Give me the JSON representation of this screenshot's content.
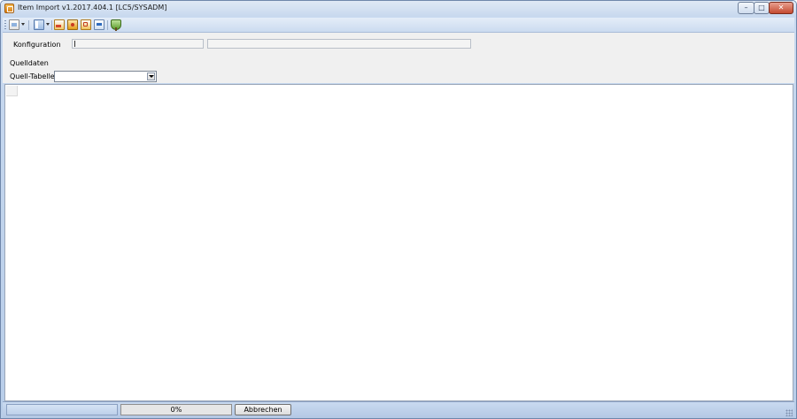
{
  "window": {
    "title": "Item Import v1.2017.404.1 [LC5/SYSADM]",
    "controls": {
      "minimize": "–",
      "maximize": "□",
      "close": "✕"
    }
  },
  "toolbar": {
    "icons": [
      "new-document-icon",
      "sheet-icon",
      "import-icon",
      "run-icon",
      "edit-icon",
      "window-icon",
      "tree-icon"
    ]
  },
  "form": {
    "konfiguration_label": "Konfiguration",
    "konfiguration_value": "",
    "konfiguration_description": "",
    "quelldaten_label": "Quelldaten",
    "quell_tabelle_label": "Quell-Tabelle",
    "quell_tabelle_value": ""
  },
  "statusbar": {
    "status_text": "",
    "progress_percent": 0,
    "progress_text": "0%",
    "cancel_label": "Abbrechen"
  },
  "colors": {
    "chrome": "#c9daf0",
    "panel": "#f0f0f0",
    "progress_fill": "#4fbf46"
  }
}
